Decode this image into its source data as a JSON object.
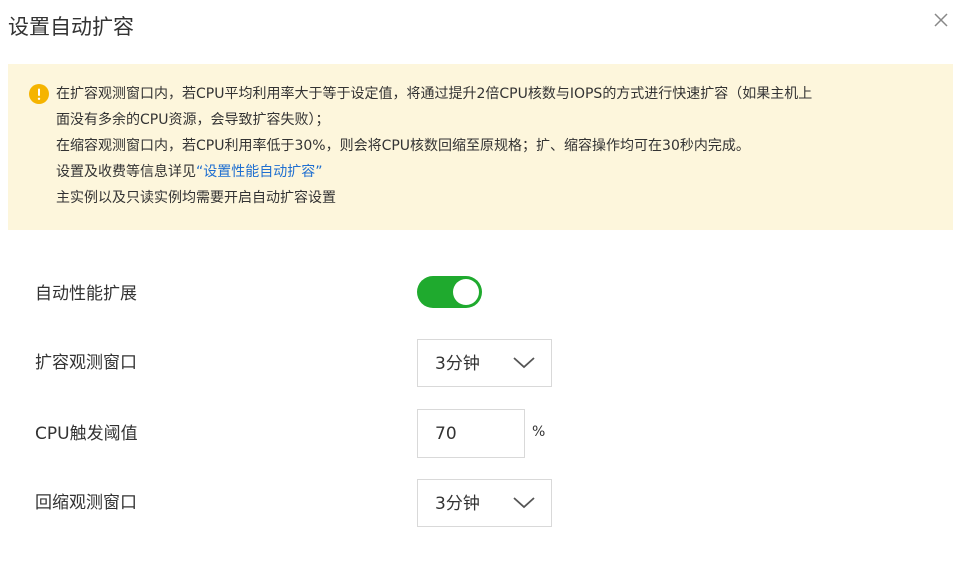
{
  "dialog": {
    "title": "设置自动扩容"
  },
  "notice": {
    "lines": [
      "在扩容观测窗口内，若CPU平均利用率大于等于设定值，将通过提升2倍CPU核数与IOPS的方式进行快速扩容（如果主机上",
      "面没有多余的CPU资源，会导致扩容失败）；",
      "在缩容观测窗口内，若CPU利用率低于30%，则会将CPU核数回缩至原规格；扩、缩容操作均可在30秒内完成。"
    ],
    "doc_prefix": "设置及收费等信息详见",
    "doc_link": "“设置性能自动扩容”",
    "last_line": "主实例以及只读实例均需要开启自动扩容设置"
  },
  "form": {
    "auto_scale_label": "自动性能扩展",
    "auto_scale_on": true,
    "scale_up_window_label": "扩容观测窗口",
    "scale_up_window_value": "3分钟",
    "cpu_threshold_label": "CPU触发阈值",
    "cpu_threshold_value": "70",
    "cpu_threshold_unit": "%",
    "scale_down_window_label": "回缩观测窗口",
    "scale_down_window_value": "3分钟"
  },
  "colors": {
    "notice_bg": "#fdf6dc",
    "warning_icon": "#f5b400",
    "toggle_on": "#1faa2e",
    "link": "#1f6fd0"
  }
}
